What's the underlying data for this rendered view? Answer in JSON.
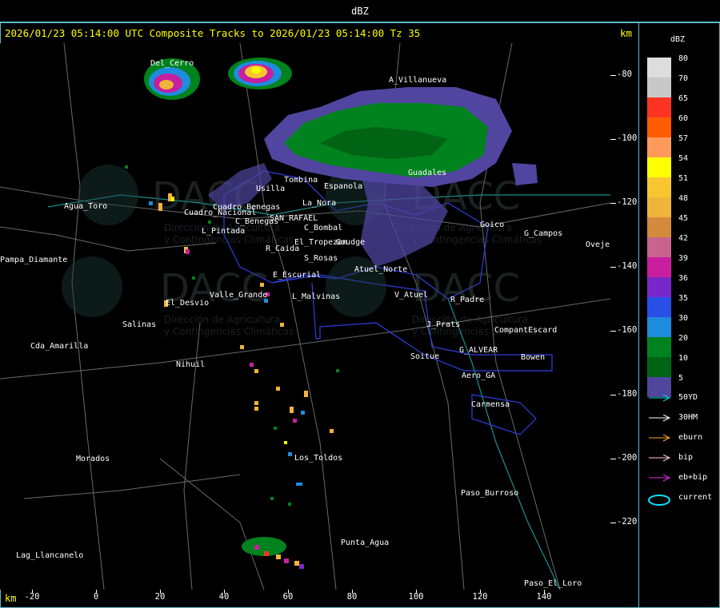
{
  "window": {
    "title": "dBZ"
  },
  "header": {
    "text": "2026/01/23 05:14:00 UTC Composite Tracks to 2026/01/23 05:14:00 Tz 35",
    "units_right": "km",
    "units_bottom": "km"
  },
  "axes": {
    "y_ticks": [
      "-80",
      "-100",
      "-120",
      "-140",
      "-160",
      "-180",
      "-200",
      "-220"
    ],
    "x_ticks": [
      "-20",
      "0",
      "20",
      "40",
      "60",
      "80",
      "100",
      "120",
      "140"
    ]
  },
  "legend": {
    "title": "dBZ",
    "levels": [
      {
        "label": "80",
        "color": "#dddddd"
      },
      {
        "label": "70",
        "color": "#c8c8c8"
      },
      {
        "label": "65",
        "color": "#ff3322"
      },
      {
        "label": "60",
        "color": "#ff5d00"
      },
      {
        "label": "57",
        "color": "#ff9a5a"
      },
      {
        "label": "54",
        "color": "#ffff00"
      },
      {
        "label": "51",
        "color": "#f7c631"
      },
      {
        "label": "48",
        "color": "#f0b43c"
      },
      {
        "label": "45",
        "color": "#d48a3c"
      },
      {
        "label": "42",
        "color": "#c8648c"
      },
      {
        "label": "39",
        "color": "#c81ea0"
      },
      {
        "label": "36",
        "color": "#7828c8"
      },
      {
        "label": "35",
        "color": "#2850e6"
      },
      {
        "label": "30",
        "color": "#1e8cdc"
      },
      {
        "label": "20",
        "color": "#00821e"
      },
      {
        "label": "10",
        "color": "#006414"
      },
      {
        "label": "5",
        "color": "#50469b"
      }
    ],
    "tracks": [
      {
        "label": "50YD",
        "color": "#00dcdc"
      },
      {
        "label": "30HM",
        "color": "#ffffff"
      },
      {
        "label": "eburn",
        "color": "#ffaa28"
      },
      {
        "label": "bip",
        "color": "#ffc8d8"
      },
      {
        "label": "eb+bip",
        "color": "#e628e6"
      },
      {
        "label": "current",
        "color": "#00e6ff"
      }
    ]
  },
  "map": {
    "watermark": {
      "brand": "DACC",
      "line1": "Dirección de Agricultura",
      "line2": "y Contingencias Climáticas"
    },
    "places": [
      "A_Villanueva",
      "Guadales",
      "Tombina",
      "Usilla",
      "Espanola",
      "La_Nora",
      "C_Benegas",
      "SAN_RAFAEL",
      "C_Bombal",
      "El_Tropezon",
      "Goudge",
      "R_Caida",
      "S_Rosas",
      "Atuel_Norte",
      "E_Escurial",
      "Valle_Grande",
      "El_Desvio",
      "L_Malvinas",
      "V_Atuel",
      "R_Padre",
      "J_Prats",
      "CompantEscard",
      "G_ALVEAR",
      "Soitue",
      "Bowen",
      "Aero_GA",
      "Carmensa",
      "Los_Toldos",
      "Morados",
      "Paso_Burroso",
      "Punta_Agua",
      "Lag_Llancanelo",
      "Paso_El_Loro",
      "Salinas",
      "Cda_Amarilla",
      "Nihuil",
      "Agua_Toro",
      "Pampa_Diamante",
      "Goico",
      "G_Campos",
      "Ovejero",
      "L_Pintada",
      "Cuadro_Nacional",
      "Cuadro_Benegas",
      "Del_Cerro"
    ]
  }
}
